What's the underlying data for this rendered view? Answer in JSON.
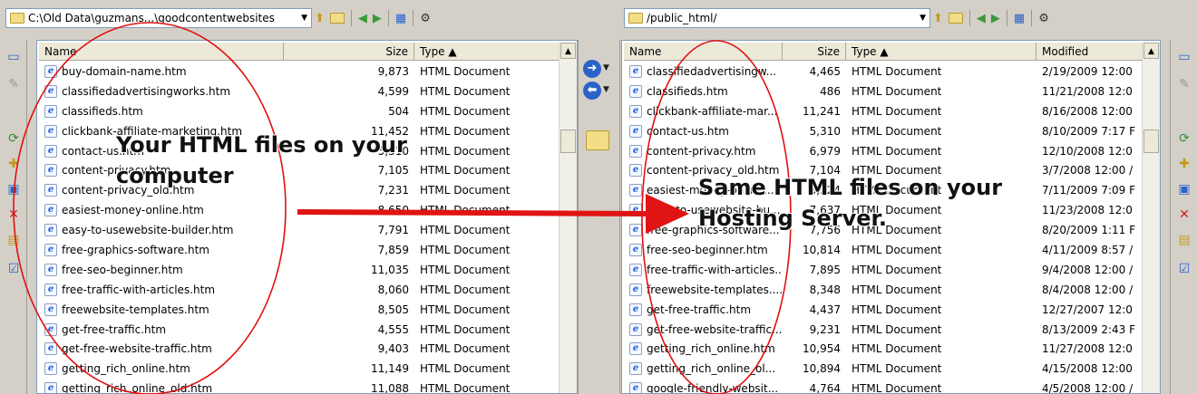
{
  "left_pane": {
    "path": "C:\\Old Data\\guzmans...\\goodcontentwebsites",
    "columns": {
      "name": "Name",
      "size": "Size",
      "type": "Type ▲"
    },
    "files": [
      {
        "name": "buy-domain-name.htm",
        "size": "9,873",
        "type": "HTML Document"
      },
      {
        "name": "classifiedadvertisingworks.htm",
        "size": "4,599",
        "type": "HTML Document"
      },
      {
        "name": "classifieds.htm",
        "size": "504",
        "type": "HTML Document"
      },
      {
        "name": "clickbank-affiliate-marketing.htm",
        "size": "11,452",
        "type": "HTML Document"
      },
      {
        "name": "contact-us.htm",
        "size": "5,310",
        "type": "HTML Document"
      },
      {
        "name": "content-privacy.htm",
        "size": "7,105",
        "type": "HTML Document"
      },
      {
        "name": "content-privacy_old.htm",
        "size": "7,231",
        "type": "HTML Document"
      },
      {
        "name": "easiest-money-online.htm",
        "size": "8,650",
        "type": "HTML Document"
      },
      {
        "name": "easy-to-usewebsite-builder.htm",
        "size": "7,791",
        "type": "HTML Document"
      },
      {
        "name": "free-graphics-software.htm",
        "size": "7,859",
        "type": "HTML Document"
      },
      {
        "name": "free-seo-beginner.htm",
        "size": "11,035",
        "type": "HTML Document"
      },
      {
        "name": "free-traffic-with-articles.htm",
        "size": "8,060",
        "type": "HTML Document"
      },
      {
        "name": "freewebsite-templates.htm",
        "size": "8,505",
        "type": "HTML Document"
      },
      {
        "name": "get-free-traffic.htm",
        "size": "4,555",
        "type": "HTML Document"
      },
      {
        "name": "get-free-website-traffic.htm",
        "size": "9,403",
        "type": "HTML Document"
      },
      {
        "name": "getting_rich_online.htm",
        "size": "11,149",
        "type": "HTML Document"
      },
      {
        "name": "getting_rich_online_old.htm",
        "size": "11,088",
        "type": "HTML Document"
      }
    ]
  },
  "right_pane": {
    "path": "/public_html/",
    "columns": {
      "name": "Name",
      "size": "Size",
      "type": "Type ▲",
      "modified": "Modified"
    },
    "files": [
      {
        "name": "classifiedadvertisingw...",
        "size": "4,465",
        "type": "HTML Document",
        "modified": "2/19/2009 12:00"
      },
      {
        "name": "classifieds.htm",
        "size": "486",
        "type": "HTML Document",
        "modified": "11/21/2008 12:0"
      },
      {
        "name": "clickbank-affiliate-mar...",
        "size": "11,241",
        "type": "HTML Document",
        "modified": "8/16/2008 12:00"
      },
      {
        "name": "contact-us.htm",
        "size": "5,310",
        "type": "HTML Document",
        "modified": "8/10/2009 7:17 F"
      },
      {
        "name": "content-privacy.htm",
        "size": "6,979",
        "type": "HTML Document",
        "modified": "12/10/2008 12:0"
      },
      {
        "name": "content-privacy_old.htm",
        "size": "7,104",
        "type": "HTML Document",
        "modified": "3/7/2008 12:00 /"
      },
      {
        "name": "easiest-money-online...",
        "size": "8,524",
        "type": "HTML Document",
        "modified": "7/11/2009 7:09 F"
      },
      {
        "name": "easy-to-usewebsite-bu...",
        "size": "7,637",
        "type": "HTML Document",
        "modified": "11/23/2008 12:0"
      },
      {
        "name": "free-graphics-software...",
        "size": "7,756",
        "type": "HTML Document",
        "modified": "8/20/2009 1:11 F"
      },
      {
        "name": "free-seo-beginner.htm",
        "size": "10,814",
        "type": "HTML Document",
        "modified": "4/11/2009 8:57 /"
      },
      {
        "name": "free-traffic-with-articles...",
        "size": "7,895",
        "type": "HTML Document",
        "modified": "9/4/2008 12:00 /"
      },
      {
        "name": "freewebsite-templates....",
        "size": "8,348",
        "type": "HTML Document",
        "modified": "8/4/2008 12:00 /"
      },
      {
        "name": "get-free-traffic.htm",
        "size": "4,437",
        "type": "HTML Document",
        "modified": "12/27/2007 12:0"
      },
      {
        "name": "get-free-website-traffic...",
        "size": "9,231",
        "type": "HTML Document",
        "modified": "8/13/2009 2:43 F"
      },
      {
        "name": "getting_rich_online.htm",
        "size": "10,954",
        "type": "HTML Document",
        "modified": "11/27/2008 12:0"
      },
      {
        "name": "getting_rich_online_ol...",
        "size": "10,894",
        "type": "HTML Document",
        "modified": "4/15/2008 12:00"
      },
      {
        "name": "google-friendly-websit...",
        "size": "4,764",
        "type": "HTML Document",
        "modified": "4/5/2008 12:00 /"
      }
    ]
  },
  "callouts": {
    "left_line1": "Your HTML files on your",
    "left_line2": "computer",
    "right_line1": "Same HTML files on your",
    "right_line2": "Hosting Server."
  },
  "colors": {
    "annotation_red": "#e01010",
    "arrow_red": "#e01414",
    "transfer_blue": "#2a63c8"
  },
  "icons": {
    "file": "ie-html-document-icon",
    "folder": "folder-icon",
    "transfer_right": "arrow-right-circle-icon",
    "transfer_left": "arrow-left-circle-icon"
  }
}
